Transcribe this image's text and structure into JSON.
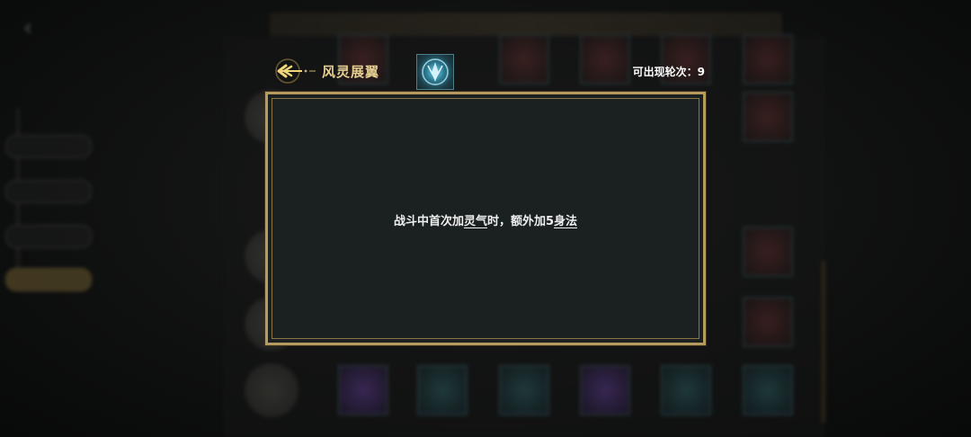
{
  "popup": {
    "skill_name": "风灵展翼",
    "round_label": "可出现轮次：",
    "round_value": "9",
    "description": {
      "part1": "战斗中首次加",
      "keyword1": "灵气",
      "part2": "时，额外加5",
      "keyword2": "身法"
    }
  },
  "icons": {
    "header_arrow": "winged-arrow-icon",
    "skill": "wind-spirit-wing-icon",
    "background_back": "back-arrow-icon"
  },
  "colors": {
    "title_gold": "#e6cf92",
    "panel_border": "#b69a5e",
    "panel_fill": "#1b2121",
    "text": "#f0f0f0"
  }
}
